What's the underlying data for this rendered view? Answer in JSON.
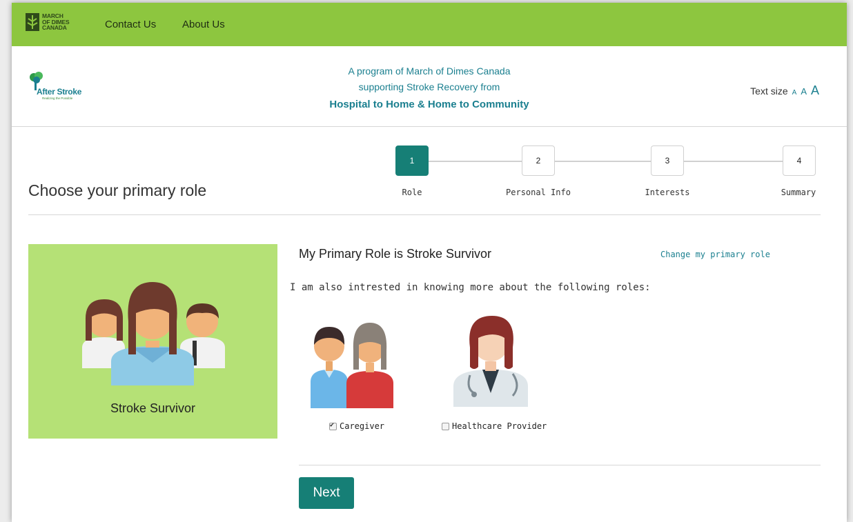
{
  "topbar": {
    "logo_lines": [
      "MARCH",
      "OF DIMES",
      "CANADA"
    ],
    "nav": [
      {
        "label": "Contact Us"
      },
      {
        "label": "About Us"
      }
    ]
  },
  "header": {
    "logo_title": "After Stroke",
    "logo_sub": "Realizing the Possible",
    "tagline_1": "A program of March of Dimes Canada",
    "tagline_2": "supporting Stroke Recovery from",
    "tagline_3": "Hospital to Home & Home to Community",
    "text_size_label": "Text size",
    "text_size_options": [
      "A",
      "A",
      "A"
    ]
  },
  "page": {
    "title": "Choose your primary role"
  },
  "steps": [
    {
      "number": "1",
      "label": "Role",
      "active": true
    },
    {
      "number": "2",
      "label": "Personal Info",
      "active": false
    },
    {
      "number": "3",
      "label": "Interests",
      "active": false
    },
    {
      "number": "4",
      "label": "Summary",
      "active": false
    }
  ],
  "role_card": {
    "label": "Stroke Survivor"
  },
  "content": {
    "primary_heading": "My Primary Role is Stroke Survivor",
    "change_link": "Change my primary role",
    "also_text": "I am also intrested in knowing more about the following roles:",
    "options": [
      {
        "label": "Caregiver",
        "checked": true
      },
      {
        "label": "Healthcare Provider",
        "checked": false
      }
    ],
    "next_label": "Next"
  },
  "colors": {
    "topbar": "#8dc63f",
    "accent_teal": "#167f76",
    "card_green": "#b5e176",
    "link_teal": "#1a7f8f"
  }
}
